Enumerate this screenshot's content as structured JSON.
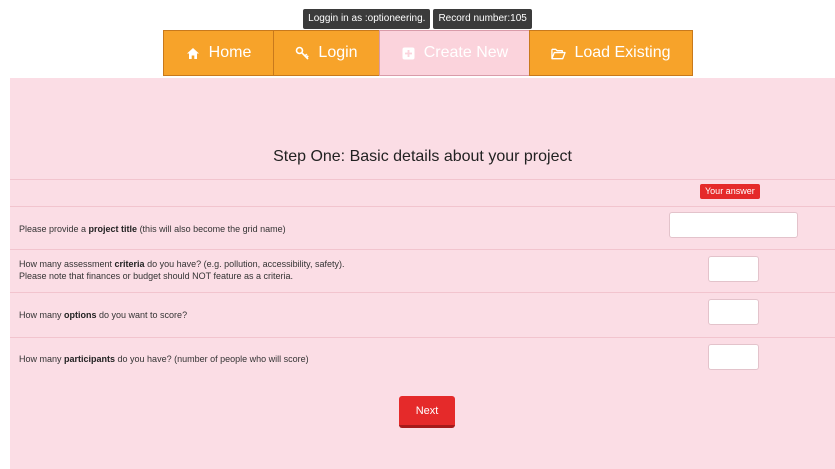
{
  "status": {
    "login": "Loggin in as :optioneering.",
    "record": "Record number:105"
  },
  "nav": {
    "home": "Home",
    "login": "Login",
    "create_new": "Create New",
    "load_existing": "Load Existing"
  },
  "form": {
    "heading": "Step One: Basic details about your project",
    "answer_label": "Your answer",
    "q1": {
      "pre": "Please provide a ",
      "bold": "project title",
      "post": " (this will also become the grid name)"
    },
    "q2": {
      "pre": "How many assessment ",
      "bold": "criteria",
      "post": " do you have? (e.g. pollution, accessibility, safety).",
      "line2": "Please note that finances or budget should NOT feature as a criteria."
    },
    "q3": {
      "pre": "How many ",
      "bold": "options",
      "post": " do you want to score?"
    },
    "q4": {
      "pre": "How many ",
      "bold": "participants",
      "post": " do you have? (number of people who will score)"
    },
    "next_label": "Next"
  },
  "colors": {
    "nav_orange": "#f7a32a",
    "nav_active": "#fbd3dc",
    "panel_pink": "#fbdde5",
    "accent_red": "#e52a2a"
  }
}
